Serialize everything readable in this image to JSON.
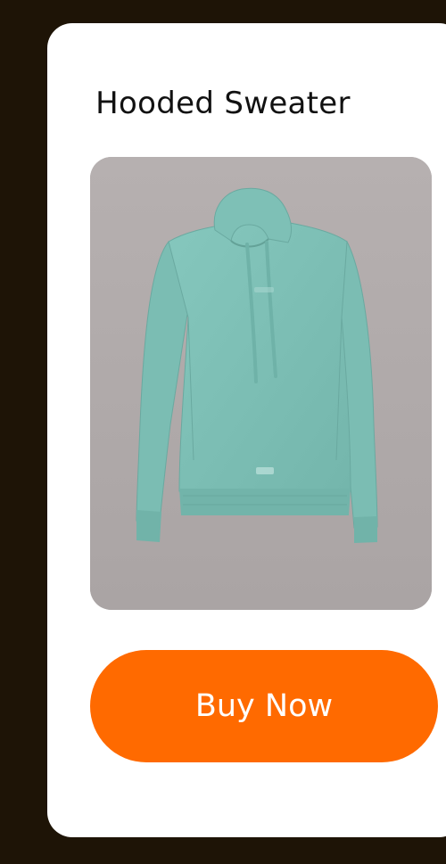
{
  "product": {
    "title": "Hooded Sweater",
    "image": {
      "subject": "hooded-sweater",
      "background_color": "#b1abab",
      "garment_color": "#7ec0b7"
    }
  },
  "actions": {
    "buy_label": "Buy Now"
  },
  "colors": {
    "page_background": "#1e1406",
    "card_background": "#ffffff",
    "accent": "#ff6a00",
    "button_text": "#ffffff"
  }
}
